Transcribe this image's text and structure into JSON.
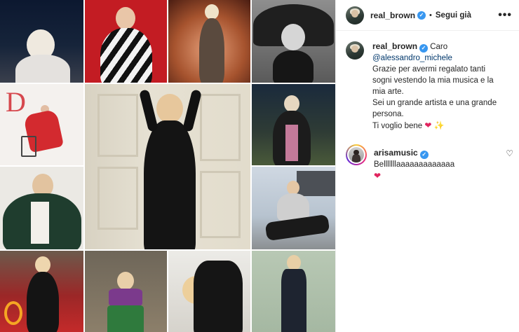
{
  "post": {
    "username": "real_brown",
    "separator": "•",
    "follow_label": "Segui già",
    "more_label": "•••"
  },
  "caption": {
    "username": "real_brown",
    "greeting": "Caro",
    "mention": "@alessandro_michele",
    "line1": "Grazie per avermi regalato tanti sogni vestendo la mia musica e la mia arte.",
    "line2": "Sei un grande artista e una grande persona.",
    "line3": "Ti voglio bene",
    "emoji_heart": "❤",
    "emoji_sparkle": "✨"
  },
  "comment": {
    "username": "arisamusic",
    "text": "Belllllllaaaaaaaaaaaaa",
    "emoji_heart": "❤",
    "like_icon": "heart-outline-icon"
  },
  "icons": {
    "verified_check": "✓",
    "like_glyph": "♡"
  },
  "colors": {
    "verified": "#3897f0",
    "mention": "#00376b",
    "heart": "#e0245e"
  }
}
